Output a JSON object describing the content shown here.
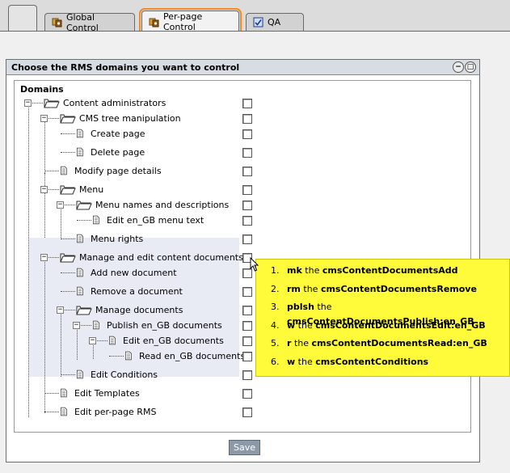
{
  "tabs": [
    {
      "label": "Global Control",
      "active": false
    },
    {
      "label": "Per-page Control",
      "active": true
    },
    {
      "label": "QA",
      "active": false
    }
  ],
  "panel": {
    "title": "Choose the RMS domains you want to control"
  },
  "tree": {
    "header": "Domains",
    "items": [
      {
        "label": "Content administrators",
        "icon": "folder-open"
      },
      {
        "label": "CMS tree manipulation",
        "icon": "folder-open"
      },
      {
        "label": "Create page",
        "icon": "document"
      },
      {
        "label": "Delete page",
        "icon": "document"
      },
      {
        "label": "Modify page details",
        "icon": "document"
      },
      {
        "label": "Menu",
        "icon": "folder-open"
      },
      {
        "label": "Menu names and descriptions",
        "icon": "folder-open"
      },
      {
        "label": "Edit en_GB menu text",
        "icon": "document"
      },
      {
        "label": "Menu rights",
        "icon": "document"
      },
      {
        "label": "Manage and edit content documents",
        "icon": "folder-open"
      },
      {
        "label": "Add new document",
        "icon": "document"
      },
      {
        "label": "Remove a document",
        "icon": "document"
      },
      {
        "label": "Manage documents",
        "icon": "folder-open"
      },
      {
        "label": "Publish en_GB documents",
        "icon": "document"
      },
      {
        "label": "Edit en_GB documents",
        "icon": "document"
      },
      {
        "label": "Read en_GB documents",
        "icon": "document"
      },
      {
        "label": "Edit Conditions",
        "icon": "document"
      },
      {
        "label": "Edit Templates",
        "icon": "document"
      },
      {
        "label": "Edit per-page RMS",
        "icon": "document"
      }
    ]
  },
  "tooltip": {
    "items": [
      {
        "perm": "mk",
        "mid": "the",
        "domain": "cmsContentDocumentsAdd"
      },
      {
        "perm": "rm",
        "mid": "the",
        "domain": "cmsContentDocumentsRemove"
      },
      {
        "perm": "pblsh",
        "mid": "the",
        "domain": "cmsContentDocumentsPublish:en_GB"
      },
      {
        "perm": "w",
        "mid": "the",
        "domain": "cmsContentDocumentsEdit:en_GB"
      },
      {
        "perm": "r",
        "mid": "the",
        "domain": "cmsContentDocumentsRead:en_GB"
      },
      {
        "perm": "w",
        "mid": "the",
        "domain": "cmsContentConditions"
      }
    ]
  },
  "actions": {
    "save_label": "Save"
  },
  "colors": {
    "tab_highlight": "#f08a24",
    "tooltip_bg": "#fffb3b",
    "save_bg": "#8c9aa8"
  }
}
